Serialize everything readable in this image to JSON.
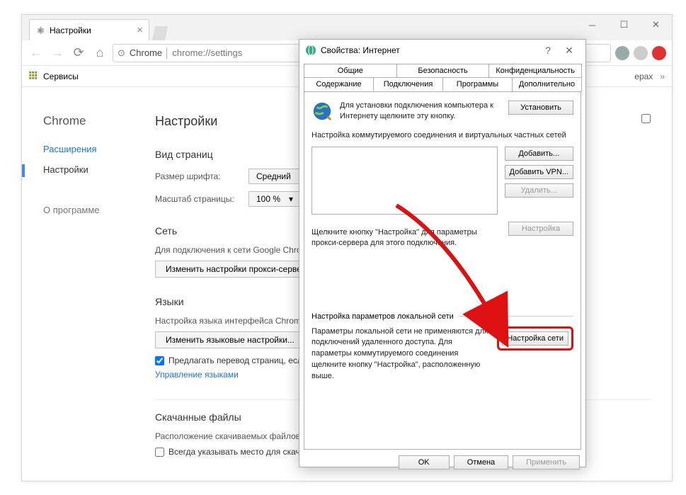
{
  "browser": {
    "tab_title": "Настройки",
    "address_host": "Chrome",
    "address_path": "chrome://settings",
    "bookmarks_label": "Сервисы",
    "other_bookmarks": "ерах"
  },
  "sidebar": {
    "title": "Chrome",
    "items": [
      {
        "label": "Расширения"
      },
      {
        "label": "Настройки"
      },
      {
        "label": "О программе"
      }
    ]
  },
  "page": {
    "title": "Настройки",
    "view_section": "Вид страниц",
    "font_size_label": "Размер шрифта:",
    "font_size_value": "Средний",
    "zoom_label": "Масштаб страницы:",
    "zoom_value": "100 %",
    "network_section": "Сеть",
    "network_hint": "Для подключения к сети Google Chrom",
    "proxy_button": "Изменить настройки прокси-сервера",
    "lang_section": "Языки",
    "lang_hint": "Настройка языка интерфейса Chrome и",
    "lang_button": "Изменить языковые настройки...",
    "translate_check": "Предлагать перевод страниц, если",
    "lang_link": "Управление языками",
    "downloads_section": "Скачанные файлы",
    "downloads_hint": "Расположение скачиваемых файлов:",
    "downloads_check": "Всегда указывать место для скачивания"
  },
  "dialog": {
    "title": "Свойства: Интернет",
    "tabs_row1": [
      "Общие",
      "Безопасность",
      "Конфиденциальность"
    ],
    "tabs_row2": [
      "Содержание",
      "Подключения",
      "Программы",
      "Дополнительно"
    ],
    "setup_text": "Для установки подключения компьютера к Интернету щелкните эту кнопку.",
    "setup_btn": "Установить",
    "dial_label": "Настройка коммутируемого соединения и виртуальных частных сетей",
    "add_btn": "Добавить...",
    "add_vpn_btn": "Добавить VPN...",
    "remove_btn": "Удалить...",
    "settings_btn": "Настройка",
    "dial_note": "Щелкните кнопку \"Настройка\" для параметры прокси-сервера для этого подключения.",
    "lan_group_label": "Настройка параметров локальной сети",
    "lan_text": "Параметры локальной сети не применяются для подключений удаленного доступа. Для параметры коммутируемого соединения щелкните кнопку \"Настройка\", расположенную выше.",
    "lan_btn": "Настройка сети",
    "ok": "OK",
    "cancel": "Отмена",
    "apply": "Применить"
  }
}
